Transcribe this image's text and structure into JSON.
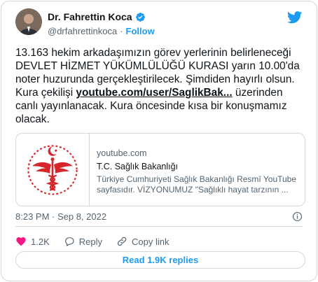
{
  "author": {
    "name": "Dr. Fahrettin Koca",
    "handle": "@drfahrettinkoca",
    "separator": "·",
    "follow_label": "Follow"
  },
  "tweet": {
    "text_before_link": "13.163 hekim arkadaşımızın görev yerlerinin belirleneceği DEVLET HİZMET YÜKÜMLÜLÜĞÜ KURASI yarın 10.00'da noter huzurunda gerçekleştirilecek. Şimdiden hayırlı olsun. Kura çekilişi ",
    "link_text": "youtube.com/user/SaglikBak...",
    "text_after_link": " üzerinden canlı yayınlanacak. Kura öncesinde kısa bir konuşmamız olacak."
  },
  "link_card": {
    "domain": "youtube.com",
    "title": "T.C. Sağlık Bakanlığı",
    "description": "Türkiye Cumhuriyeti Sağlık Bakanlığı Resmî YouTube sayfasıdır. VİZYONUMUZ \"Sağlıklı hayat tarzının ...",
    "logo_icon": "ministry-of-health-logo"
  },
  "timestamp": "8:23 PM · Sep 8, 2022",
  "actions": {
    "like_count": "1.2K",
    "reply_label": "Reply",
    "copy_label": "Copy link"
  },
  "read_replies_label": "Read 1.9K replies",
  "colors": {
    "accent": "#1d9bf0",
    "like": "#f91880",
    "logo_red": "#d7262b"
  }
}
